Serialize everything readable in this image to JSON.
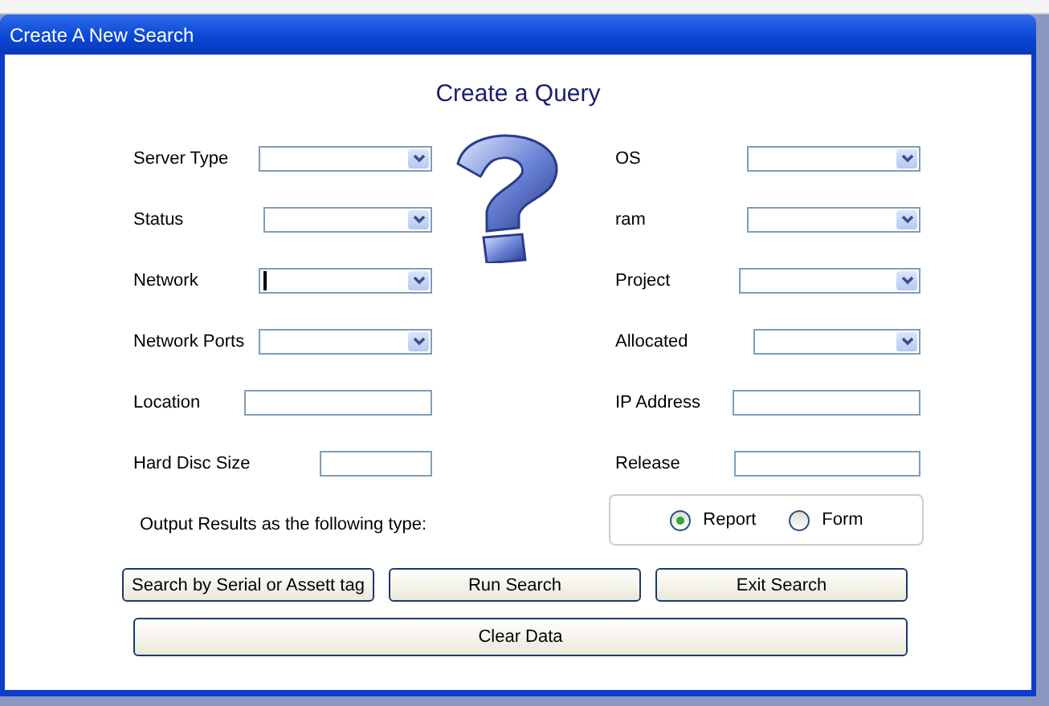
{
  "window": {
    "title": "Create A New Search"
  },
  "heading": "Create a Query",
  "left_fields": [
    {
      "label": "Server Type",
      "kind": "dropdown",
      "focused": false
    },
    {
      "label": "Status",
      "kind": "dropdown",
      "focused": false
    },
    {
      "label": "Network",
      "kind": "dropdown",
      "focused": true
    },
    {
      "label": "Network Ports",
      "kind": "dropdown",
      "focused": false
    },
    {
      "label": "Location",
      "kind": "text",
      "focused": false
    },
    {
      "label": "Hard Disc Size",
      "kind": "text",
      "focused": false
    }
  ],
  "right_fields": [
    {
      "label": "OS",
      "kind": "dropdown",
      "focused": false
    },
    {
      "label": "ram",
      "kind": "dropdown",
      "focused": false
    },
    {
      "label": "Project",
      "kind": "dropdown",
      "focused": false
    },
    {
      "label": "Allocated",
      "kind": "dropdown",
      "focused": false
    },
    {
      "label": "IP Address",
      "kind": "text",
      "focused": false
    },
    {
      "label": "Release",
      "kind": "text",
      "focused": false
    }
  ],
  "output": {
    "label": "Output Results as the following type:",
    "options": [
      {
        "label": "Report",
        "selected": true
      },
      {
        "label": "Form",
        "selected": false
      }
    ]
  },
  "buttons": [
    "Search by Serial or Assett tag",
    "Run Search",
    "Exit Search"
  ],
  "clear_button": "Clear Data"
}
